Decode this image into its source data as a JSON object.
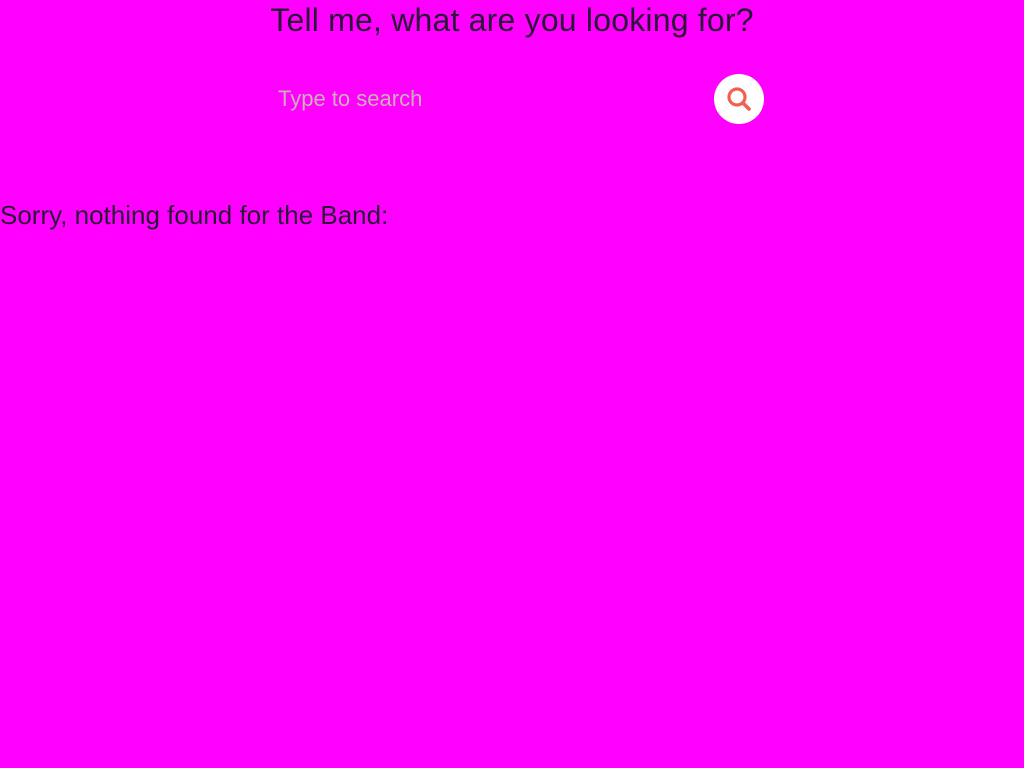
{
  "header": {
    "title": "Tell me, what are you looking for?"
  },
  "search": {
    "placeholder": "Type to search",
    "value": "",
    "button_icon": "search-icon"
  },
  "results": {
    "message": "Sorry, nothing found for the Band:"
  },
  "colors": {
    "background": "#ff00ff",
    "text": "#2a1638",
    "placeholder": "#c9b0b5",
    "button_bg": "#ffffff",
    "icon_accent": "#f2604f"
  }
}
